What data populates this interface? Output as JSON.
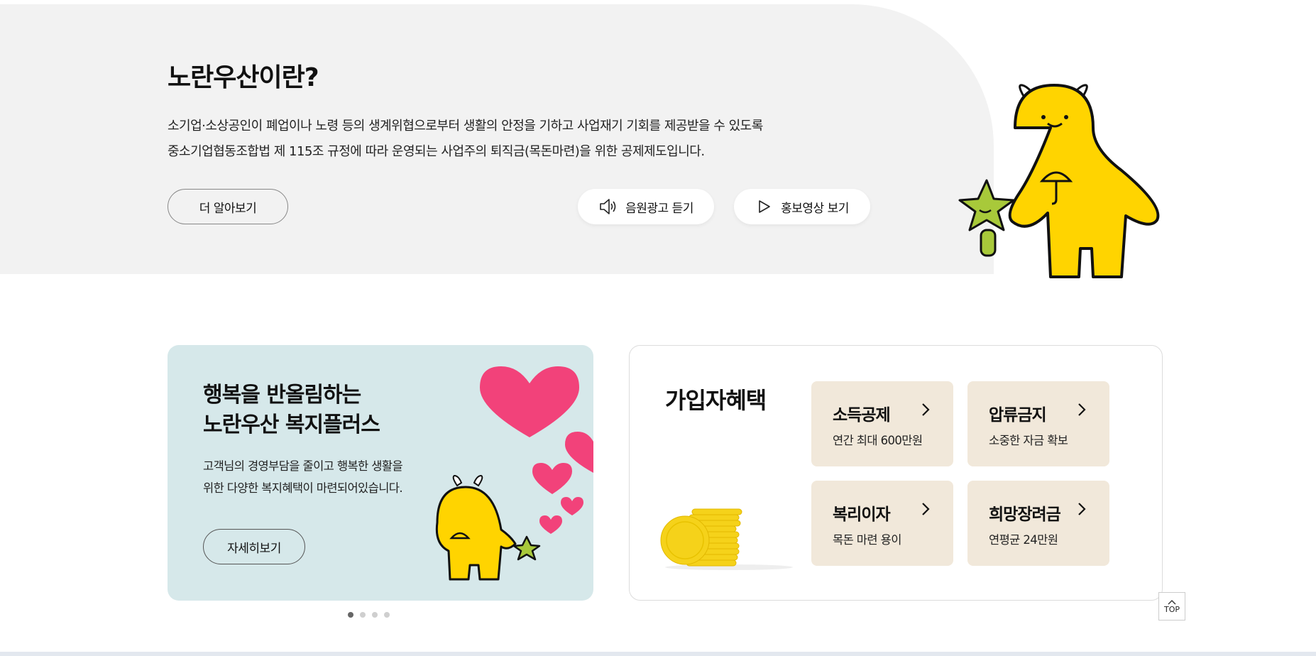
{
  "hero": {
    "title": "노란우산이란?",
    "desc_line1": "소기업·소상공인이 폐업이나 노령 등의 생계위협으로부터 생활의 안정을 기하고 사업재기 기회를 제공받을 수 있도록",
    "desc_line2": "중소기업협동조합법 제 115조 규정에 따라 운영되는 사업주의 퇴직금(목돈마련)을 위한 공제제도입니다.",
    "learn_more_label": "더 알아보기",
    "audio_ad_label": "음원광고 듣기",
    "promo_video_label": "홍보영상 보기"
  },
  "welfare": {
    "title_line1": "행복을 반올림하는",
    "title_line2": "노란우산 복지플러스",
    "desc_line1": "고객님의 경영부담을 줄이고 행복한 생활을",
    "desc_line2": "위한 다양한 복지혜택이 마련되어있습니다.",
    "details_label": "자세히보기"
  },
  "carousel": {
    "total": 4,
    "active": 1
  },
  "benefits": {
    "title": "가입자혜택",
    "items": [
      {
        "title": "소득공제",
        "desc": "연간 최대 600만원"
      },
      {
        "title": "압류금지",
        "desc": "소중한 자금 확보"
      },
      {
        "title": "복리이자",
        "desc": "목돈 마련 용이"
      },
      {
        "title": "희망장려금",
        "desc": "연평균 24만원"
      }
    ]
  },
  "top_button": {
    "label": "TOP"
  },
  "colors": {
    "hero_bg": "#f2f2f2",
    "welfare_bg": "#d6e8ea",
    "tile_bg": "#f1e8da",
    "mascot_yellow": "#ffd400",
    "heart_pink": "#f2427a",
    "star_green": "#a8c93a"
  },
  "icons": {
    "audio": "speaker-icon",
    "video": "play-icon",
    "chevron": "chevron-right-icon",
    "top": "chevron-up-icon"
  }
}
